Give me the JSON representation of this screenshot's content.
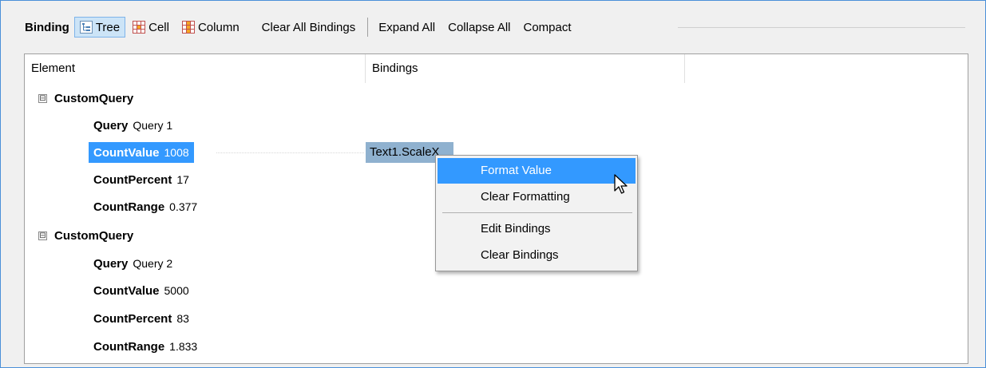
{
  "toolbar": {
    "heading": "Binding",
    "tree_label": "Tree",
    "cell_label": "Cell",
    "column_label": "Column",
    "clear_all_label": "Clear All Bindings",
    "expand_all_label": "Expand All",
    "collapse_all_label": "Collapse All",
    "compact_label": "Compact"
  },
  "grid": {
    "columns": [
      "Element",
      "Bindings"
    ],
    "groups": [
      {
        "expander": "⊟",
        "name": "CustomQuery",
        "rows": [
          {
            "key": "Query",
            "value": "Query 1"
          },
          {
            "key": "CountValue",
            "value": "1008",
            "selected": true,
            "binding": "Text1.ScaleX"
          },
          {
            "key": "CountPercent",
            "value": "17"
          },
          {
            "key": "CountRange",
            "value": "0.377"
          }
        ]
      },
      {
        "expander": "⊟",
        "name": "CustomQuery",
        "rows": [
          {
            "key": "Query",
            "value": "Query 2"
          },
          {
            "key": "CountValue",
            "value": "5000"
          },
          {
            "key": "CountPercent",
            "value": "83"
          },
          {
            "key": "CountRange",
            "value": "1.833"
          }
        ]
      }
    ]
  },
  "context_menu": {
    "items": [
      "Format Value",
      "Clear Formatting",
      "Edit Bindings",
      "Clear Bindings"
    ],
    "highlighted": "Format Value"
  },
  "icons": {
    "tree": "tree-view-icon",
    "cell": "cell-grid-icon",
    "column": "column-grid-icon",
    "cursor": "mouse-pointer-icon"
  },
  "colors": {
    "selection": "#3399ff",
    "binding_cell": "#8fb1cf",
    "active_tool": "#cce4f7"
  }
}
